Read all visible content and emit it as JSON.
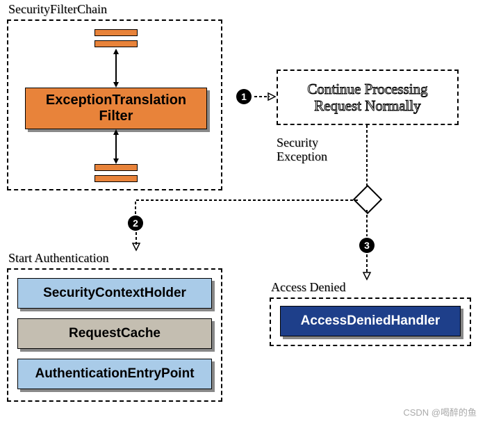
{
  "chain": {
    "title": "SecurityFilterChain",
    "filter": "ExceptionTranslation\nFilter"
  },
  "steps": {
    "s1": "1",
    "s2": "2",
    "s3": "3"
  },
  "continueBox": "Continue Processing\nRequest Normally",
  "securityException": "Security\nException",
  "startAuth": {
    "title": "Start Authentication",
    "box1": "SecurityContextHolder",
    "box2": "RequestCache",
    "box3": "AuthenticationEntryPoint"
  },
  "accessDenied": {
    "title": "Access Denied",
    "box": "AccessDeniedHandler"
  },
  "watermark": "CSDN @喝醉的鱼"
}
